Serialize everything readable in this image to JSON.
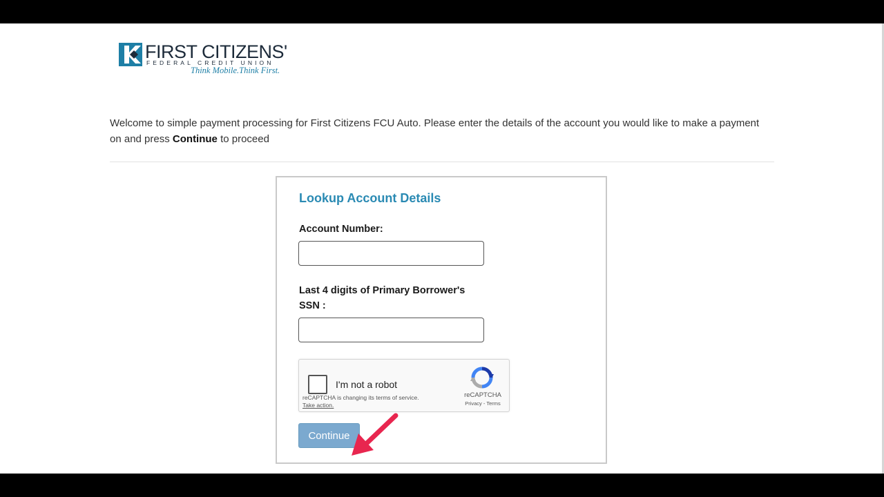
{
  "logo": {
    "name": "FIRST CITIZENS'",
    "subtitle": "FEDERAL CREDIT UNION",
    "tagline": "Think Mobile.Think First."
  },
  "intro": {
    "text_before": "Welcome to simple payment processing for First Citizens FCU Auto. Please enter the details of the account you would like to make a payment on and press ",
    "bold": "Continue",
    "text_after": " to proceed"
  },
  "form": {
    "title": "Lookup Account Details",
    "account_number_label": "Account Number:",
    "account_number_value": "",
    "ssn_label": "Last 4 digits of Primary Borrower's SSN :",
    "ssn_value": "",
    "continue_label": "Continue"
  },
  "recaptcha": {
    "checkbox_label": "I'm not a robot",
    "checked": false,
    "notice": "reCAPTCHA is changing its terms of service.",
    "take_action": "Take action.",
    "brand": "reCAPTCHA",
    "links": "Privacy - Terms"
  },
  "colors": {
    "heading": "#2a8ab3",
    "button": "#7ba9cf",
    "annotation_arrow": "#e8264f",
    "logo_blue": "#1e7fa6"
  }
}
